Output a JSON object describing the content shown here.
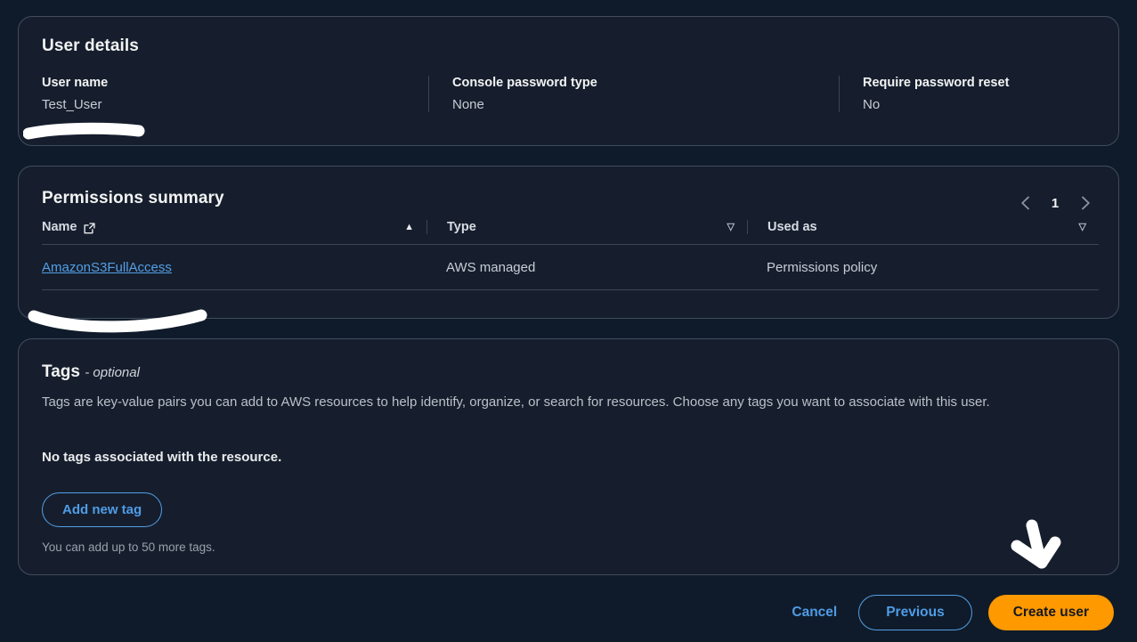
{
  "user_details": {
    "title": "User details",
    "fields": [
      {
        "label": "User name",
        "value": "Test_User"
      },
      {
        "label": "Console password type",
        "value": "None"
      },
      {
        "label": "Require password reset",
        "value": "No"
      }
    ]
  },
  "permissions": {
    "title": "Permissions summary",
    "pagination": {
      "prev_icon": "chevron-left-icon",
      "page": "1",
      "next_icon": "chevron-right-icon"
    },
    "columns": [
      {
        "label": "Name",
        "icon": "external-link-icon",
        "sort": "ascending"
      },
      {
        "label": "Type",
        "sort": "none"
      },
      {
        "label": "Used as",
        "sort": "none"
      }
    ],
    "rows": [
      {
        "name": "AmazonS3FullAccess",
        "type": "AWS managed",
        "used_as": "Permissions policy"
      }
    ]
  },
  "tags": {
    "title": "Tags",
    "optional_suffix": "- optional",
    "description": "Tags are key-value pairs you can add to AWS resources to help identify, organize, or search for resources. Choose any tags you want to associate with this user.",
    "empty_state": "No tags associated with the resource.",
    "add_button": "Add new tag",
    "hint": "You can add up to 50 more tags."
  },
  "footer": {
    "cancel": "Cancel",
    "previous": "Previous",
    "create": "Create user"
  },
  "colors": {
    "page_background": "#0f1b2a",
    "card_background": "#161e2d",
    "card_border": "#414d5c",
    "link": "#539fe5",
    "primary_button": "#ff9900",
    "annotation": "#ffffff"
  },
  "annotations": [
    {
      "name": "username-highlight",
      "shape": "brush-stroke"
    },
    {
      "name": "policy-highlight",
      "shape": "brush-stroke"
    },
    {
      "name": "create-user-arrow",
      "shape": "hand-drawn-arrow"
    }
  ]
}
